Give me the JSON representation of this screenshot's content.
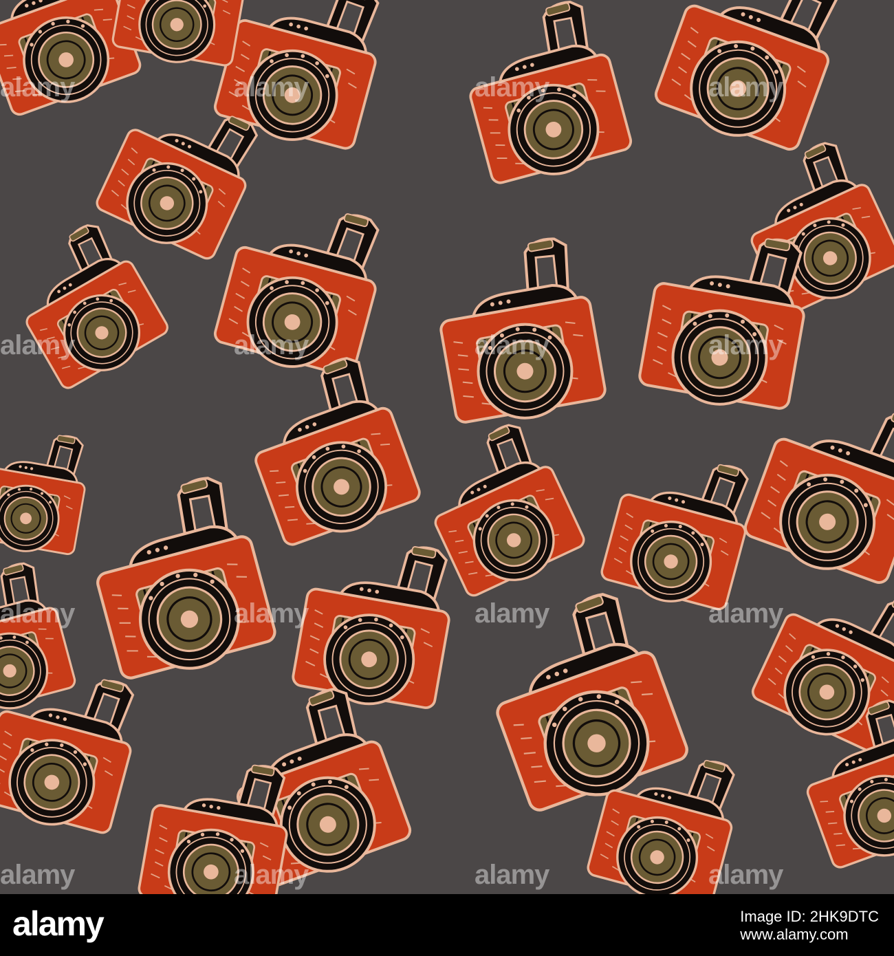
{
  "colors": {
    "background": "#4b4747",
    "body_orange": "#c83b18",
    "body_black": "#120d0b",
    "outline_peach": "#e9b79b",
    "lens_olive": "#6a5b34",
    "footer_black": "#000000"
  },
  "illustration": {
    "subject": "camera-icon",
    "count": 26
  },
  "watermark": {
    "text": "alamy"
  },
  "footer": {
    "logo": "alamy",
    "image_id_line": "Image ID: 2HK9DTC",
    "site": "www.alamy.com"
  }
}
